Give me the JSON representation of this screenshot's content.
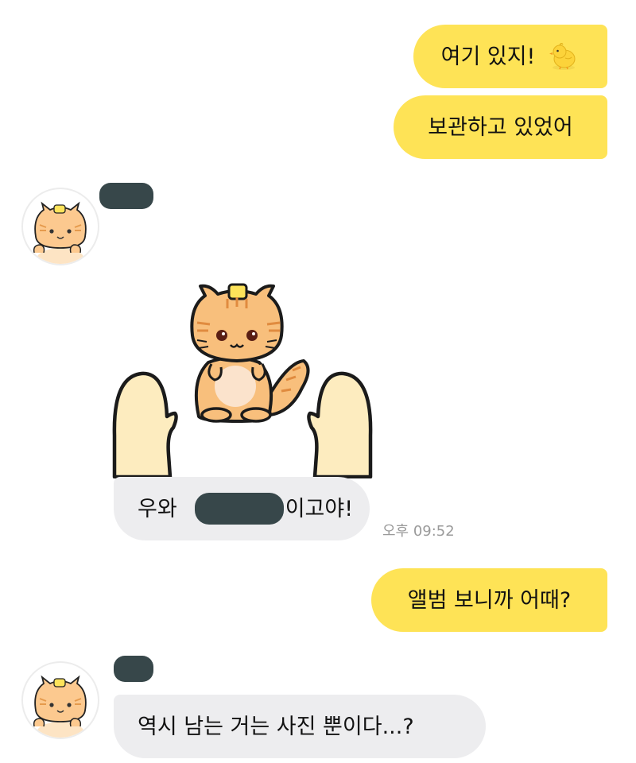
{
  "messages": {
    "m1": {
      "text": "여기 있지!",
      "emoji": "chick-icon"
    },
    "m2": {
      "text": "보관하고 있었어"
    },
    "m3": {
      "text_before": "우와",
      "text_after": "이고야!",
      "time": "오후 09:52"
    },
    "m4": {
      "text": "앨범 보니까 어때?"
    },
    "m5": {
      "text": "역시 남는 거는 사진 뿐이다...?"
    }
  },
  "colors": {
    "my_bubble": "#fee356",
    "their_bubble": "#ededef",
    "redaction": "#37474a",
    "background": "#ffffff"
  }
}
